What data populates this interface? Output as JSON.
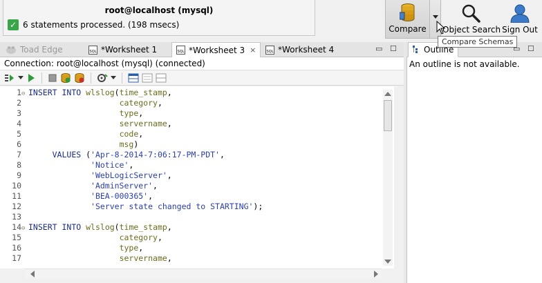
{
  "status": {
    "title": "root@localhost (mysql)",
    "message": "6 statements processed. (198 msecs)"
  },
  "toolbar": {
    "compare_label": "Compare",
    "object_search_label": "Object Search",
    "sign_out_label": "Sign Out"
  },
  "tooltip": "Compare Schemas",
  "tabs": [
    {
      "label": "Toad Edge"
    },
    {
      "label": "*Worksheet 1"
    },
    {
      "label": "*Worksheet 3"
    },
    {
      "label": "*Worksheet 4"
    }
  ],
  "tab_close_glyph": "×",
  "panel_controls": {
    "minimize": "▭",
    "maximize": "☐"
  },
  "connection": "Connection: root@localhost (mysql) (connected)",
  "outline": {
    "tab_label": "Outline",
    "message": "An outline is not available."
  },
  "editor": {
    "lines": [
      {
        "n": "1",
        "fold": "⊖",
        "text": "INSERT INTO wlslog(time_stamp,"
      },
      {
        "n": "2",
        "fold": "",
        "text": "                   category,"
      },
      {
        "n": "3",
        "fold": "",
        "text": "                   type,"
      },
      {
        "n": "4",
        "fold": "",
        "text": "                   servername,"
      },
      {
        "n": "5",
        "fold": "",
        "text": "                   code,"
      },
      {
        "n": "6",
        "fold": "",
        "text": "                   msg)"
      },
      {
        "n": "7",
        "fold": "",
        "text": "     VALUES ('Apr-8-2014-7:06:17-PM-PDT',"
      },
      {
        "n": "8",
        "fold": "",
        "text": "             'Notice',"
      },
      {
        "n": "9",
        "fold": "",
        "text": "             'WebLogicServer',"
      },
      {
        "n": "10",
        "fold": "",
        "text": "             'AdminServer',"
      },
      {
        "n": "11",
        "fold": "",
        "text": "             'BEA-000365',"
      },
      {
        "n": "12",
        "fold": "",
        "text": "             'Server state changed to STARTING');"
      },
      {
        "n": "13",
        "fold": "",
        "text": ""
      },
      {
        "n": "14",
        "fold": "⊖",
        "text": "INSERT INTO wlslog(time_stamp,"
      },
      {
        "n": "15",
        "fold": "",
        "text": "                   category,"
      },
      {
        "n": "16",
        "fold": "",
        "text": "                   type,"
      },
      {
        "n": "17",
        "fold": "",
        "text": "                   servername,"
      }
    ]
  },
  "colors": {
    "check": "#3aa64a",
    "keyword": "#1b2c84",
    "string": "#2a3faa"
  }
}
